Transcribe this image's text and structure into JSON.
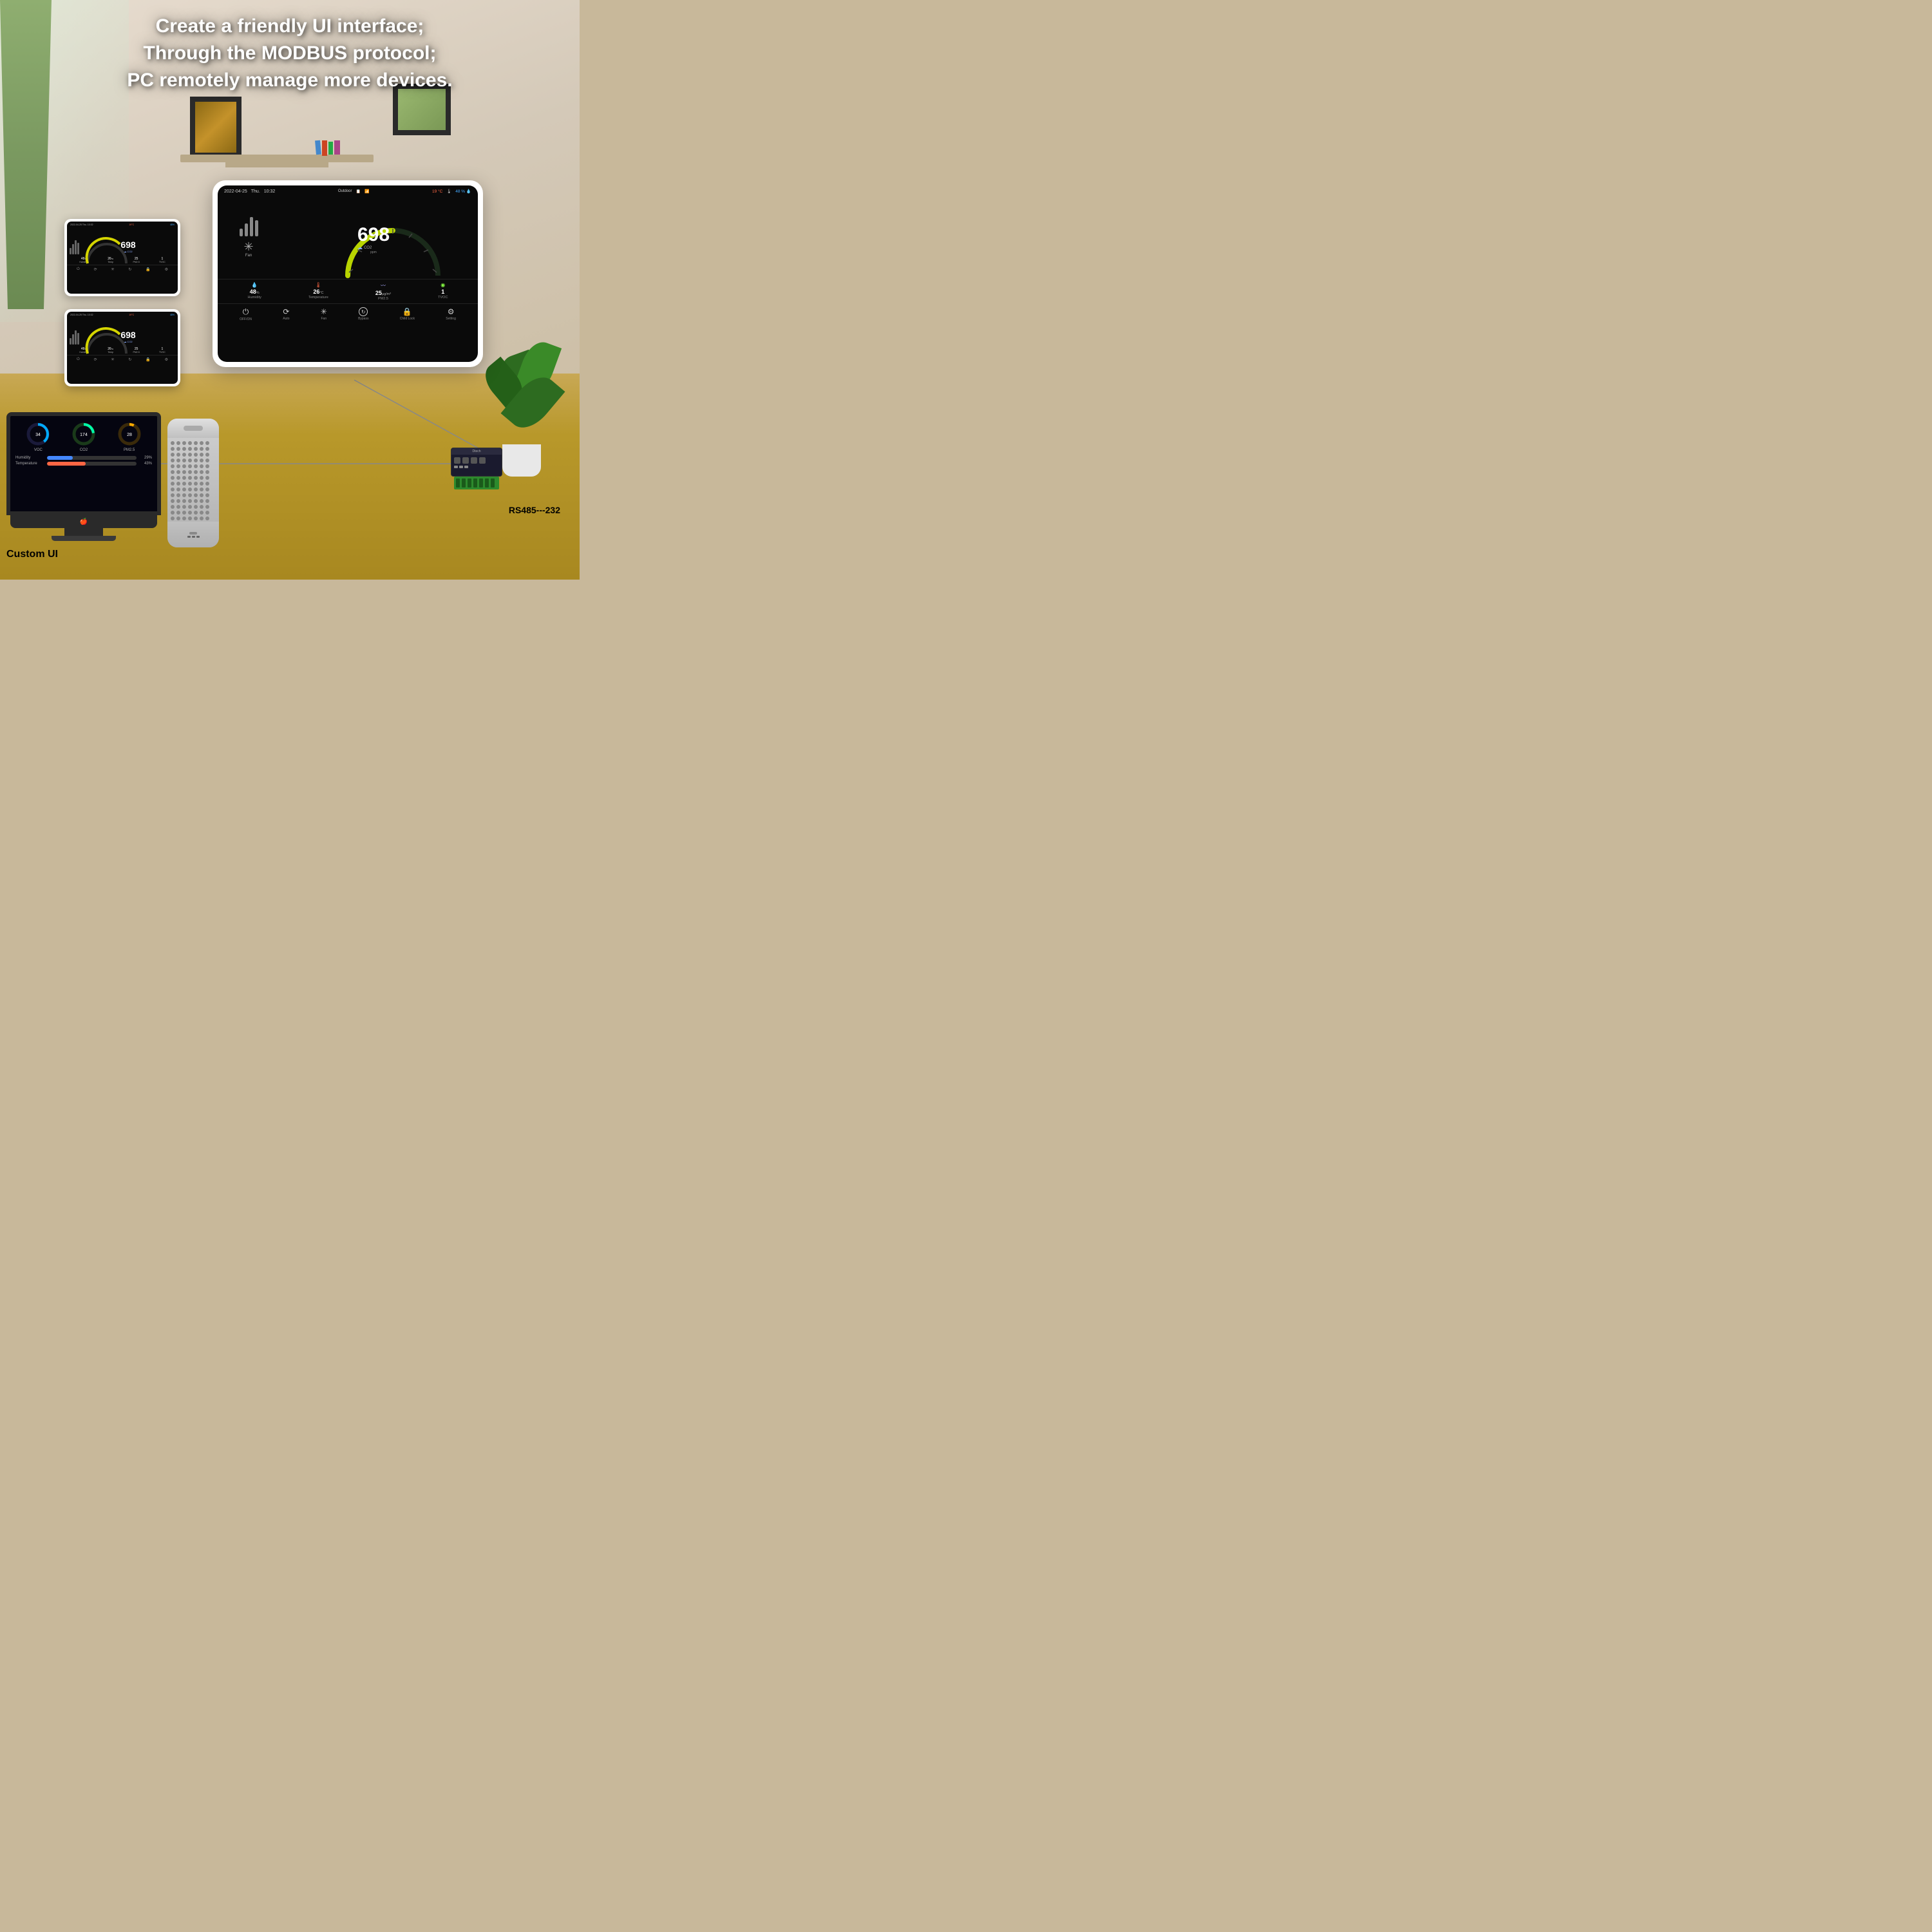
{
  "header": {
    "line1": "Create a friendly UI interface;",
    "line2": "Through the MODBUS protocol;",
    "line3": "PC remotely manage more devices."
  },
  "main_device": {
    "date": "2022-04-25",
    "day": "Thu.",
    "time": "10:32",
    "outdoor_label": "Outdoor",
    "temp": "19 °C",
    "humidity": "48 %",
    "co2_value": "698",
    "co2_unit": "ppm",
    "co2_label": "CO2",
    "humidity_value": "48",
    "humidity_unit": "%",
    "humidity_label": "Humidity",
    "temp_value": "26",
    "temp_unit": "°C",
    "temp_label": "Temperature",
    "pm25_value": "25",
    "pm25_unit": "µg/m³",
    "pm25_label": "PM2.5",
    "tvoc_value": "1",
    "tvoc_label": "TVOC",
    "fan_label": "Fan",
    "controls": [
      {
        "icon": "⏻",
        "label": "OFF/ON"
      },
      {
        "icon": "⟳",
        "label": "Auto"
      },
      {
        "icon": "✳",
        "label": "Fan"
      },
      {
        "icon": "⟳",
        "label": "Bypass"
      },
      {
        "icon": "🔒",
        "label": "Child Lock"
      },
      {
        "icon": "⚙",
        "label": "Setting"
      }
    ]
  },
  "footer": {
    "custom_ui_label": "Custom UI",
    "rs485_label": "RS485---232"
  },
  "monitor": {
    "gauges": [
      {
        "label": "VOC",
        "value": "34",
        "color": "#00aaff"
      },
      {
        "label": "CO2",
        "value": "174",
        "color": "#00ffaa"
      },
      {
        "label": "PM2.5",
        "value": "28",
        "color": "#ffaa00"
      }
    ],
    "bars": [
      {
        "label": "Humidity",
        "value": 29,
        "display": "29%",
        "color": "#4488ff"
      },
      {
        "label": "Temperature",
        "value": 43,
        "display": "43%",
        "color": "#ff6644"
      }
    ]
  }
}
